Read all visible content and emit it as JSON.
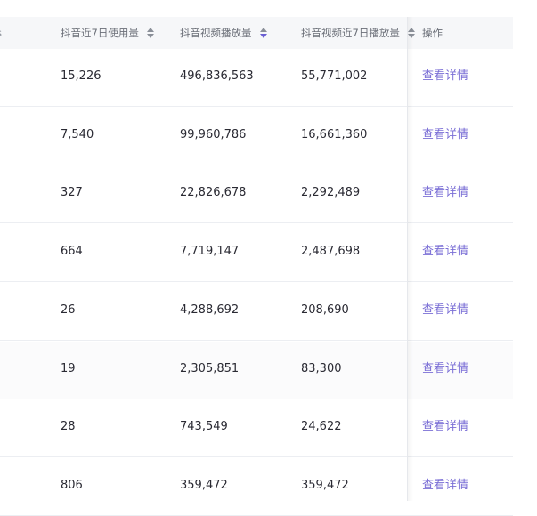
{
  "header": {
    "col1": "抖音近7日使用量",
    "col2": "抖音视频播放量",
    "col3": "抖音视频近7日播放量",
    "op": "操作",
    "edge": "s"
  },
  "colors": {
    "link": "#7b6fd6",
    "sort_inactive": "#8a8f98",
    "sort_active": "#6a5fd3",
    "header_bg": "#f6f7f9"
  },
  "rows": [
    {
      "c1": "15,226",
      "c2": "496,836,563",
      "c3": "55,771,002",
      "op": "查看详情"
    },
    {
      "c1": "7,540",
      "c2": "99,960,786",
      "c3": "16,661,360",
      "op": "查看详情"
    },
    {
      "c1": "327",
      "c2": "22,826,678",
      "c3": "2,292,489",
      "op": "查看详情"
    },
    {
      "c1": "664",
      "c2": "7,719,147",
      "c3": "2,487,698",
      "op": "查看详情"
    },
    {
      "c1": "26",
      "c2": "4,288,692",
      "c3": "208,690",
      "op": "查看详情"
    },
    {
      "c1": "19",
      "c2": "2,305,851",
      "c3": "83,300",
      "op": "查看详情"
    },
    {
      "c1": "28",
      "c2": "743,549",
      "c3": "24,622",
      "op": "查看详情"
    },
    {
      "c1": "806",
      "c2": "359,472",
      "c3": "359,472",
      "op": "查看详情"
    }
  ]
}
